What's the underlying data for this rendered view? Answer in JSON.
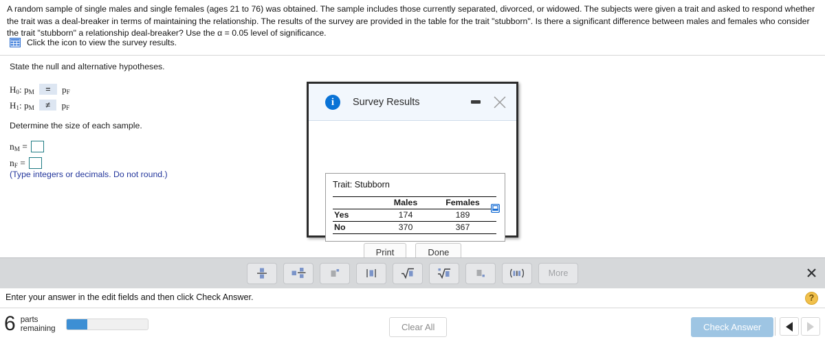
{
  "question": {
    "stem": "A random sample of single males and single females (ages 21 to 76) was obtained. The sample includes those currently separated, divorced, or widowed. The subjects were given a trait and asked to respond whether the trait was a deal-breaker in terms of maintaining the relationship. The results of the survey are provided in the table for the trait \"stubborn\". Is there a significant difference between males and females who consider the trait \"stubborn\" a relationship deal-breaker? Use the α = 0.05 level of significance.",
    "icon_link_text": "Click the icon to view the survey results.",
    "icon_name": "grid-table-icon",
    "prompt_hypotheses": "State the null and alternative hypotheses.",
    "hypotheses": [
      {
        "label": "H₀:",
        "label_base": "H",
        "label_sub": "0",
        "left": "p",
        "left_sub": "M",
        "operator": "=",
        "right": "p",
        "right_sub": "F"
      },
      {
        "label": "H₁:",
        "label_base": "H",
        "label_sub": "1",
        "left": "p",
        "left_sub": "M",
        "operator": "≠",
        "right": "p",
        "right_sub": "F"
      }
    ],
    "operator_options": [
      "=",
      "≠",
      "<",
      ">"
    ],
    "prompt_sample_size": "Determine the size of each sample.",
    "sample_fields": [
      {
        "base": "n",
        "sub": "M",
        "equals": "=",
        "value": ""
      },
      {
        "base": "n",
        "sub": "F",
        "equals": "=",
        "value": ""
      }
    ],
    "note": "(Type integers or decimals. Do not round.)"
  },
  "dialog": {
    "title": "Survey Results",
    "info_icon": "info-icon",
    "minimize_label": "–",
    "close_label": "✕",
    "trait_label": "Trait: Stubborn",
    "copy_icon": "copy-to-spreadsheet-icon",
    "table": {
      "columns": [
        "",
        "Males",
        "Females"
      ],
      "rows": [
        {
          "label": "Yes",
          "values": [
            "174",
            "189"
          ]
        },
        {
          "label": "No",
          "values": [
            "370",
            "367"
          ]
        }
      ]
    },
    "buttons": [
      {
        "name": "print-button",
        "label": "Print"
      },
      {
        "name": "done-button",
        "label": "Done"
      }
    ]
  },
  "math_toolbar": {
    "buttons": [
      {
        "name": "fraction-button",
        "icon": "fraction-icon",
        "label": ""
      },
      {
        "name": "mixed-number-button",
        "icon": "mixed-number-icon",
        "label": ""
      },
      {
        "name": "exponent-button",
        "icon": "exponent-icon",
        "label": ""
      },
      {
        "name": "absolute-value-button",
        "icon": "absolute-value-icon",
        "label": ""
      },
      {
        "name": "square-root-button",
        "icon": "square-root-icon",
        "label": ""
      },
      {
        "name": "nth-root-button",
        "icon": "nth-root-icon",
        "label": ""
      },
      {
        "name": "subscript-button",
        "icon": "subscript-icon",
        "label": ""
      },
      {
        "name": "interval-notation-button",
        "icon": "interval-notation-icon",
        "label": ""
      },
      {
        "name": "more-button",
        "icon": "",
        "label": "More"
      }
    ],
    "close_label": "✕"
  },
  "instruction": {
    "text": "Enter your answer in the edit fields and then click Check Answer.",
    "help_label": "?"
  },
  "footer": {
    "parts_remaining_count": "6",
    "parts_label_line1": "parts",
    "parts_label_line2": "remaining",
    "progress_percent": 25,
    "clear_all_label": "Clear All",
    "check_answer_label": "Check Answer",
    "prev_label": "◀",
    "next_label": "▶"
  },
  "colors": {
    "accent_blue": "#3d8fd4",
    "check_answer_bg": "#9ec5e3",
    "note_text": "#22359b",
    "input_border": "#1d7a82",
    "toolbar_bg": "#d6d8da",
    "dialog_title_bg": "#f2f7fd",
    "help_icon_bg": "#f1c04b",
    "dropdown_highlight": "#dde6f2"
  }
}
